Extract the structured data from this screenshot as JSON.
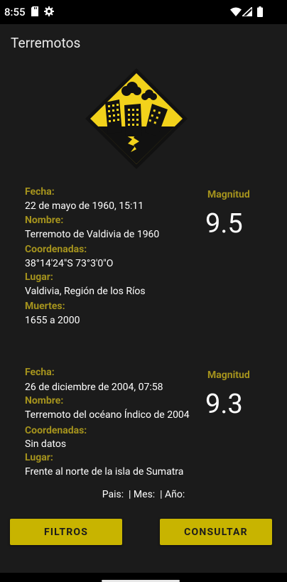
{
  "status_bar": {
    "time": "8:55",
    "icons": [
      "sim-card-icon",
      "settings-gear-icon",
      "wifi-icon",
      "signal-icon",
      "battery-icon"
    ]
  },
  "app_bar": {
    "title": "Terremotos"
  },
  "colors": {
    "accent": "#c8b400",
    "label": "#a5931d",
    "background": "#1b1b1b"
  },
  "logo": {
    "icon": "earthquake-warning-sign-icon"
  },
  "earthquakes": [
    {
      "fecha_label": "Fecha:",
      "fecha": "22 de mayo de 1960, 15:11",
      "nombre_label": "Nombre:",
      "nombre": "Terremoto de Valdivia de 1960",
      "coordenadas_label": "Coordenadas:",
      "coordenadas": "38°14'24\"S 73°3'0\"O",
      "lugar_label": "Lugar:",
      "lugar": "Valdivia, Región de los Ríos",
      "muertes_label": "Muertes:",
      "muertes": "1655 a 2000",
      "magnitud_label": "Magnitud",
      "magnitud": "9.5"
    },
    {
      "fecha_label": "Fecha:",
      "fecha": "26 de diciembre de 2004, 07:58",
      "nombre_label": "Nombre:",
      "nombre": "Terremoto del océano Índico de 2004",
      "coordenadas_label": "Coordenadas:",
      "coordenadas": "Sin datos",
      "lugar_label": "Lugar:",
      "lugar": "Frente al norte de la isla de Sumatra",
      "magnitud_label": "Magnitud",
      "magnitud": "9.3"
    }
  ],
  "filters": {
    "text": "Pais:  | Mes:  | Año:"
  },
  "buttons": {
    "filtros": "FILTROS",
    "consultar": "CONSULTAR"
  }
}
